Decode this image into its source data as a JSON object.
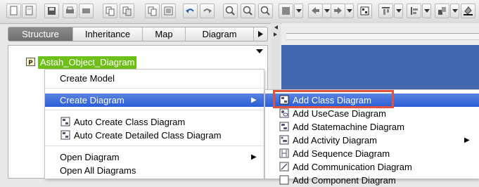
{
  "toolbar": {
    "buttons": [
      "new-file-icon",
      "open-file-icon",
      "save-icon",
      "print-icon",
      "print-preview-icon",
      "copy-icon",
      "paste-icon",
      "cut-icon",
      "copy-image-icon",
      "undo-icon",
      "redo-icon",
      "zoom-in-icon",
      "zoom-fit-icon",
      "zoom-out-icon",
      "background-icon",
      "back-icon",
      "forward-icon",
      "grid-icon",
      "align-icon",
      "arrange-icon",
      "fill-color-icon"
    ]
  },
  "tabs": [
    "Structure",
    "Inheritance",
    "Map",
    "Diagram"
  ],
  "tree": {
    "root_badge": "P",
    "root_label": "Astah_Object_Diagram"
  },
  "context_menu": {
    "create_model": "Create Model",
    "create_diagram": "Create Diagram",
    "auto_create_class": "Auto Create Class Diagram",
    "auto_create_detailed": "Auto Create Detailed Class Diagram",
    "open_diagram": "Open Diagram",
    "open_all": "Open All Diagrams"
  },
  "submenu": {
    "items": [
      "Add Class Diagram",
      "Add UseCase Diagram",
      "Add Statemachine Diagram",
      "Add Activity Diagram",
      "Add Sequence Diagram",
      "Add Communication Diagram",
      "Add Component Diagram"
    ],
    "highlight_color": "#e0513f",
    "accent": "#2a5ed6"
  }
}
